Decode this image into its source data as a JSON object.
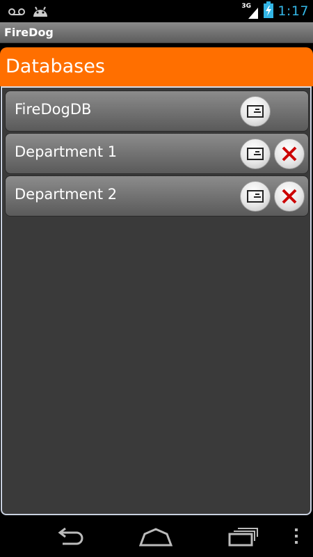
{
  "status_bar": {
    "network_label": "3G",
    "clock": "1:17",
    "icons": [
      "voicemail-icon",
      "android-icon",
      "signal-icon",
      "battery-charging-icon"
    ],
    "accent_color": "#33b5e5"
  },
  "app_bar": {
    "title": "FireDog"
  },
  "header": {
    "title": "Databases",
    "color": "#ff6f00"
  },
  "databases": [
    {
      "label": "FireDogDB",
      "has_delete": false
    },
    {
      "label": "Department 1",
      "has_delete": true
    },
    {
      "label": "Department 2",
      "has_delete": true
    }
  ],
  "row_actions": {
    "edit_icon": "card-icon",
    "delete_icon": "close-icon",
    "delete_color": "#cc0000"
  },
  "nav_bar": {
    "icons": [
      "back-icon",
      "home-icon",
      "recents-icon",
      "menu-icon"
    ]
  }
}
